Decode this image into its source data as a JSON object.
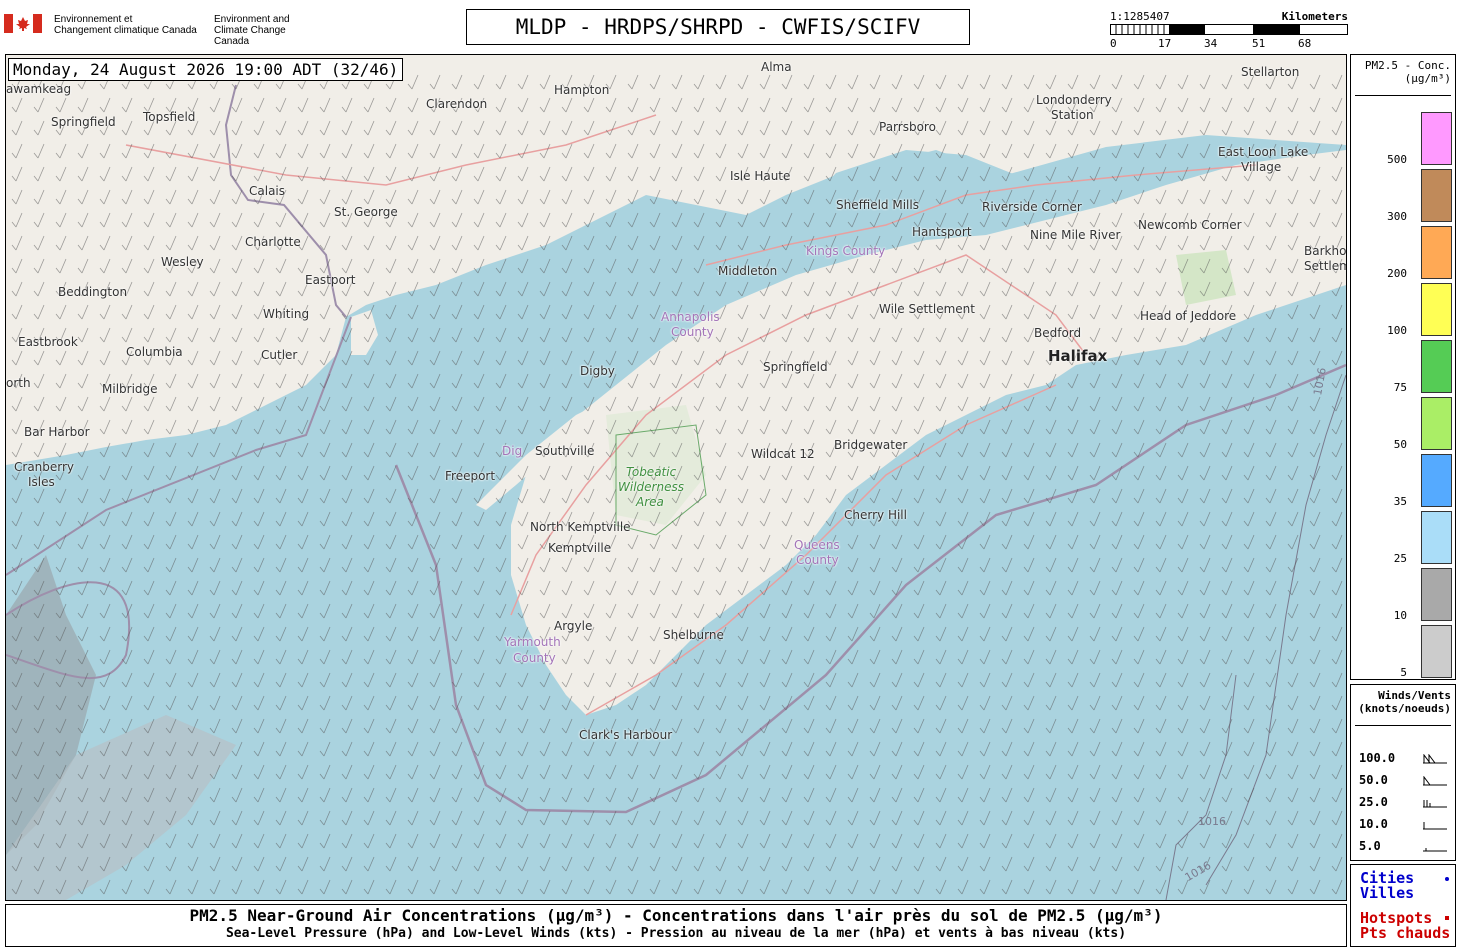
{
  "header": {
    "gov_fr_1": "Environnement et",
    "gov_fr_2": "Changement climatique Canada",
    "gov_en_1": "Environment and",
    "gov_en_2": "Climate Change Canada",
    "title": "MLDP - HRDPS/SHRPD - CWFIS/SCIFV"
  },
  "scale": {
    "ratio": "1:1285407",
    "unit": "Kilometers",
    "ticks": [
      "0",
      "17",
      "34",
      "51",
      "68"
    ]
  },
  "map": {
    "datetime": "Monday, 24 August 2026 19:00 ADT (32/46)",
    "places": [
      {
        "name": "Alma"
      },
      {
        "name": "Stellarton"
      },
      {
        "name": "Clarendon"
      },
      {
        "name": "Hampton"
      },
      {
        "name": "Londonderry"
      },
      {
        "name": "Station"
      },
      {
        "name": "Springfield"
      },
      {
        "name": "Topsfield"
      },
      {
        "name": "Parrsboro"
      },
      {
        "name": "East Loon Lake"
      },
      {
        "name": "Village"
      },
      {
        "name": "Isle Haute"
      },
      {
        "name": "Calais"
      },
      {
        "name": "St. George"
      },
      {
        "name": "Sheffield Mills"
      },
      {
        "name": "Riverside Corner"
      },
      {
        "name": "Charlotte"
      },
      {
        "name": "Hantsport"
      },
      {
        "name": "Nine Mile River"
      },
      {
        "name": "Newcomb Corner"
      },
      {
        "name": "Wesley"
      },
      {
        "name": "Eastport"
      },
      {
        "name": "Middleton"
      },
      {
        "name": "Barkho"
      },
      {
        "name": "Settlem"
      },
      {
        "name": "Beddington"
      },
      {
        "name": "Whiting"
      },
      {
        "name": "Wile Settlement"
      },
      {
        "name": "Eastbrook"
      },
      {
        "name": "Columbia"
      },
      {
        "name": "Cutler"
      },
      {
        "name": "Bedford"
      },
      {
        "name": "Head of Jeddore"
      },
      {
        "name": "Digby"
      },
      {
        "name": "Springfield"
      },
      {
        "name": "orth"
      },
      {
        "name": "Milbridge"
      },
      {
        "name": "Bar Harbor"
      },
      {
        "name": "Southville"
      },
      {
        "name": "Bridgewater"
      },
      {
        "name": "Wildcat 12"
      },
      {
        "name": "Cranberry"
      },
      {
        "name": "Isles"
      },
      {
        "name": "Freeport"
      },
      {
        "name": "North Kemptville"
      },
      {
        "name": "Cherry Hill"
      },
      {
        "name": "Kemptville"
      },
      {
        "name": "Argyle"
      },
      {
        "name": "Shelburne"
      },
      {
        "name": "Clark's Harbour"
      },
      {
        "name": "Dig"
      },
      {
        "name": "awamkeag"
      }
    ],
    "big_city": "Halifax",
    "counties": [
      {
        "name": "Kings County"
      },
      {
        "name": "Annapolis"
      },
      {
        "name": "County"
      },
      {
        "name": "Queens"
      },
      {
        "name": "County"
      },
      {
        "name": "Yarmouth"
      },
      {
        "name": "County"
      }
    ],
    "wilderness": [
      "Tobeatic",
      "Wilderness",
      "Area"
    ],
    "isobar_labels": [
      "1016",
      "1016",
      "1016"
    ]
  },
  "pm_legend": {
    "title_1": "PM2.5 - Conc.",
    "title_2": "(µg/m³)",
    "levels": [
      {
        "label": "500",
        "color": "#ff99ff"
      },
      {
        "label": "300",
        "color": "#c08a5a"
      },
      {
        "label": "200",
        "color": "#ffa955"
      },
      {
        "label": "100",
        "color": "#ffff55"
      },
      {
        "label": "75",
        "color": "#55cc55"
      },
      {
        "label": "50",
        "color": "#aaee66"
      },
      {
        "label": "35",
        "color": "#55aaff"
      },
      {
        "label": "25",
        "color": "#aaddf8"
      },
      {
        "label": "10",
        "color": "#a9a9a9"
      },
      {
        "label": "5",
        "color": "#cccccc"
      }
    ]
  },
  "wind_legend": {
    "title_1": "Winds/Vents",
    "title_2": "(knots/noeuds)",
    "rows": [
      "100.0",
      "50.0",
      "25.0",
      "10.0",
      "5.0"
    ]
  },
  "key_legend": {
    "cities_1": "Cities",
    "cities_2": "Villes",
    "hotspots_1": "Hotspots",
    "hotspots_2": "Pts chauds",
    "cities_color": "#0000cc",
    "hotspots_color": "#cc0000"
  },
  "caption": {
    "line1": "PM2.5 Near-Ground Air Concentrations (µg/m³) - Concentrations dans l'air près du sol de PM2.5 (µg/m³)",
    "line2": "Sea-Level Pressure (hPa) and Low-Level Winds (kts) - Pression au niveau de la mer (hPa) et vents à bas niveau (kts)"
  }
}
